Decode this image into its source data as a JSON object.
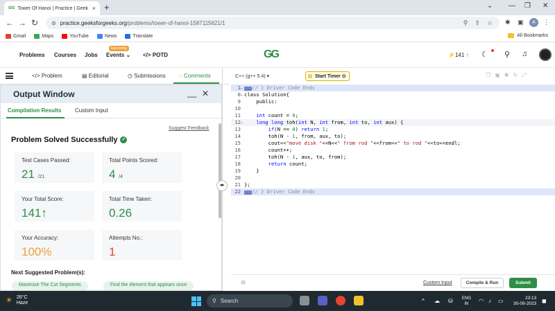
{
  "browser": {
    "tab_title": "Tower Of Hanoi | Practice | Geek",
    "tab_favicon": "GG",
    "url_domain": "practice.geeksforgeeks.org",
    "url_path": "/problems/tower-of-hanoi-1587115621/1",
    "profile_initial": "A",
    "bookmarks": [
      "Gmail",
      "Maps",
      "YouTube",
      "News",
      "Translate"
    ],
    "all_bookmarks": "All Bookmarks"
  },
  "site_header": {
    "nav": [
      "Problems",
      "Courses",
      "Jobs",
      "Events",
      "POTD"
    ],
    "upcoming_badge": "Upcoming",
    "logo": "GG",
    "streak_count": "141"
  },
  "left_tabs": [
    "Problem",
    "Editorial",
    "Submissions",
    "Comments"
  ],
  "output_window": {
    "title": "Output Window",
    "tabs": [
      "Compilation Results",
      "Custom Input"
    ],
    "suggest_feedback": "Suggest Feedback",
    "status": "Problem Solved Successfully",
    "cards": [
      {
        "label": "Test Cases Passed:",
        "value": "21",
        "suffix": "/21"
      },
      {
        "label": "Total Points Scored:",
        "value": "4",
        "suffix": "/4"
      },
      {
        "label": "Your Total Score:",
        "value": "141",
        "suffix": ""
      },
      {
        "label": "Total Time Taken:",
        "value": "0.26",
        "suffix": ""
      },
      {
        "label": "Your Accuracy:",
        "value": "100%",
        "suffix": ""
      },
      {
        "label": "Attempts No.:",
        "value": "1",
        "suffix": ""
      }
    ],
    "next_suggested_label": "Next Suggested Problem(s):",
    "suggested": [
      "Maximize The Cut Segments",
      "Find the element that appears once"
    ]
  },
  "editor": {
    "language": "C++ (g++ 5.4)",
    "timer_label": "Start Timer",
    "custom_input": "Custom Input",
    "compile_run": "Compile & Run",
    "submit": "Submit"
  },
  "taskbar": {
    "temperature": "26°C",
    "weather": "Haze",
    "search_placeholder": "Search",
    "lang_line1": "ENG",
    "lang_line2": "IN",
    "time": "23:13",
    "date": "30-09-2023"
  },
  "colors": {
    "brand_green": "#2f8d46",
    "accuracy_orange": "#f0a03a",
    "attempts_red": "#d9463b"
  }
}
